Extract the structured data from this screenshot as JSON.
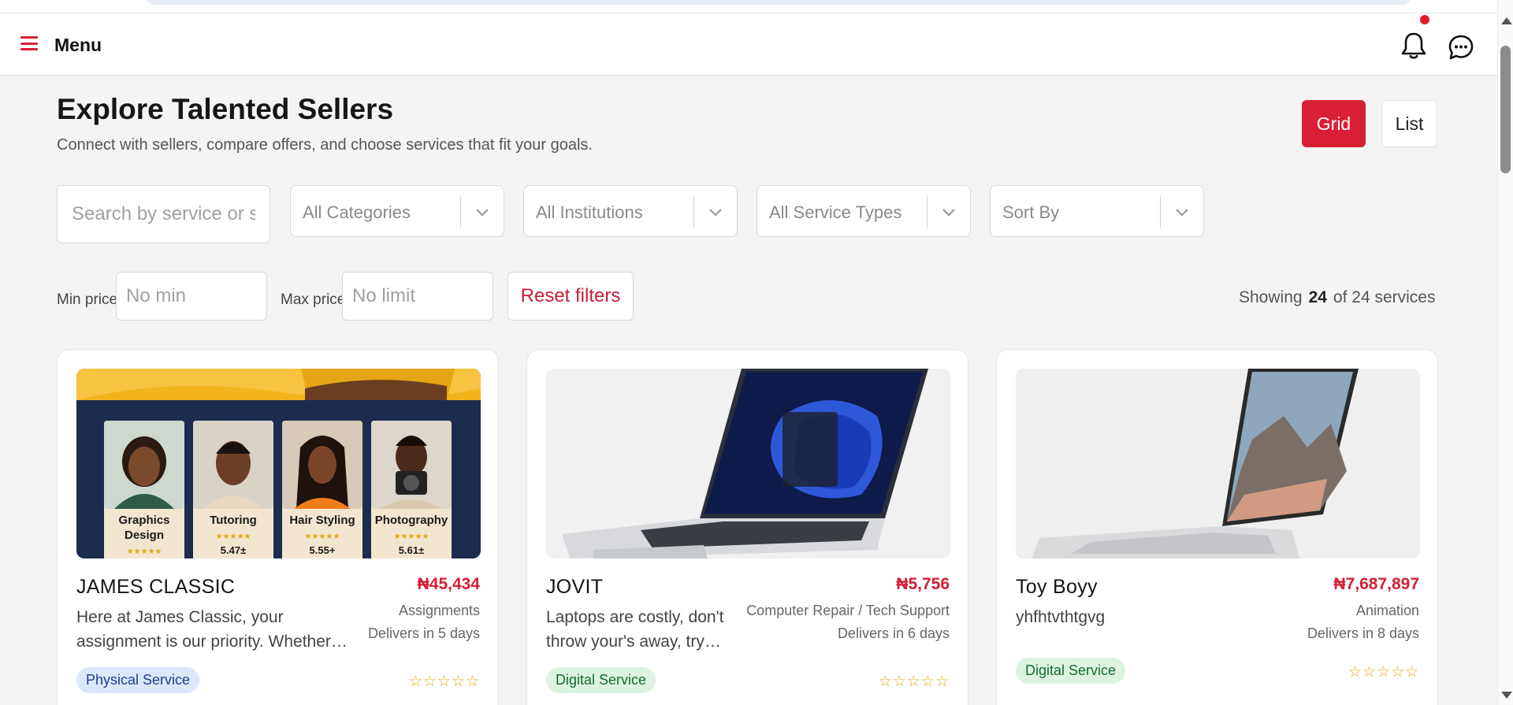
{
  "header": {
    "menu_label": "Menu"
  },
  "page": {
    "title": "Explore Talented Sellers",
    "subtitle": "Connect with sellers, compare offers, and choose services that fit your goals."
  },
  "view_toggle": {
    "grid_label": "Grid",
    "list_label": "List",
    "active": "Grid"
  },
  "filters": {
    "search_placeholder": "Search by service or seller",
    "categories": "All Categories",
    "institutions": "All Institutions",
    "service_types": "All Service Types",
    "sort_by": "Sort By",
    "min_price_label": "Min price",
    "min_price_placeholder": "No min",
    "max_price_label": "Max price",
    "max_price_placeholder": "No limit",
    "reset_label": "Reset filters"
  },
  "results": {
    "showing_prefix": "Showing",
    "count": "24",
    "showing_suffix": "of 24 services"
  },
  "cards": [
    {
      "name": "JAMES CLASSIC",
      "price": "₦45,434",
      "description": "Here at James Classic, your assignment is our priority. Whether…",
      "category": "Assignments",
      "delivery": "Delivers in 5 days",
      "badge": "Physical Service",
      "stars": "☆☆☆☆☆",
      "image_tiles": [
        {
          "label_line1": "Graphics",
          "label_line2": "Design",
          "score": "★★★★★"
        },
        {
          "label_line1": "Tutoring",
          "label_line2": "★★★★★",
          "score": "5.47±"
        },
        {
          "label_line1": "Hair Styling",
          "label_line2": "★★★★★",
          "score": "5.55+"
        },
        {
          "label_line1": "Photography",
          "label_line2": "★★★★★",
          "score": "5.61±"
        }
      ]
    },
    {
      "name": "JOVIT",
      "price": "₦5,756",
      "description": "Laptops are costly, don't throw your's away, try…",
      "category": "Computer Repair / Tech Support",
      "delivery": "Delivers in 6 days",
      "badge": "Digital Service",
      "stars": "☆☆☆☆☆"
    },
    {
      "name": "Toy Boyy",
      "price": "₦7,687,897",
      "description": "yhfhtvthtgvg",
      "category": "Animation",
      "delivery": "Delivers in 8 days",
      "badge": "Digital Service",
      "stars": "☆☆☆☆☆"
    }
  ],
  "colors": {
    "accent": "#d91f36",
    "page_bg": "#f4f4f4",
    "physical_badge_bg": "#dbe8fb",
    "digital_badge_bg": "#ddf3e2",
    "star": "#e5a612"
  }
}
